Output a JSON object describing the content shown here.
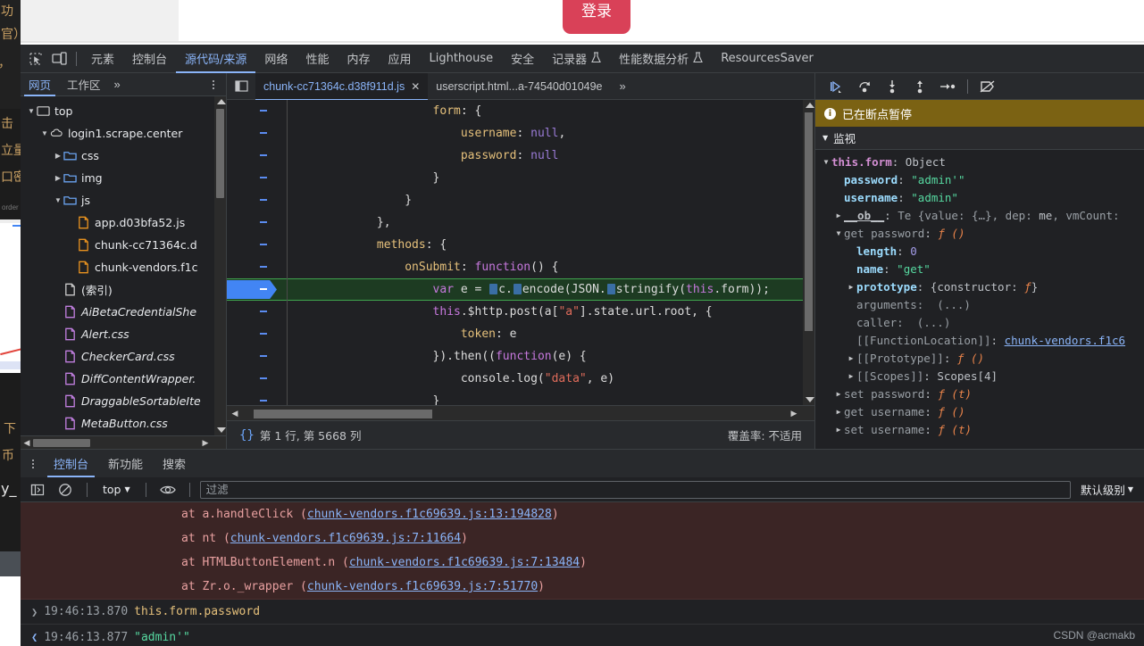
{
  "page": {
    "login_button_label": "登录"
  },
  "left_sliver": {
    "lines": [
      "击",
      "立",
      "口密",
      "下",
      "币",
      "y_"
    ],
    "small_label": "order"
  },
  "devtools": {
    "main_tabs": [
      {
        "label": "元素",
        "active": false,
        "flask": false
      },
      {
        "label": "控制台",
        "active": false,
        "flask": false
      },
      {
        "label": "源代码/来源",
        "active": true,
        "flask": false
      },
      {
        "label": "网络",
        "active": false,
        "flask": false
      },
      {
        "label": "性能",
        "active": false,
        "flask": false
      },
      {
        "label": "内存",
        "active": false,
        "flask": false
      },
      {
        "label": "应用",
        "active": false,
        "flask": false
      },
      {
        "label": "Lighthouse",
        "active": false,
        "flask": false
      },
      {
        "label": "安全",
        "active": false,
        "flask": false
      },
      {
        "label": "记录器",
        "active": false,
        "flask": true
      },
      {
        "label": "性能数据分析",
        "active": false,
        "flask": true
      },
      {
        "label": "ResourcesSaver",
        "active": false,
        "flask": false
      }
    ],
    "icons": {
      "inspect": "inspect-element-icon",
      "device": "device-toolbar-icon",
      "kebab": "more-options-icon"
    }
  },
  "navigator": {
    "tabs": [
      {
        "label": "网页",
        "active": true
      },
      {
        "label": "工作区",
        "active": false
      }
    ],
    "more_label": "»",
    "tree": [
      {
        "indent": 0,
        "twisty": "▼",
        "icon": "frame",
        "label": "top",
        "italic": false
      },
      {
        "indent": 1,
        "twisty": "▼",
        "icon": "cloud",
        "label": "login1.scrape.center",
        "italic": false
      },
      {
        "indent": 2,
        "twisty": "▶",
        "icon": "folder",
        "label": "css",
        "italic": false
      },
      {
        "indent": 2,
        "twisty": "▶",
        "icon": "folder",
        "label": "img",
        "italic": false
      },
      {
        "indent": 2,
        "twisty": "▼",
        "icon": "folder",
        "label": "js",
        "italic": false
      },
      {
        "indent": 3,
        "twisty": "",
        "icon": "file-js",
        "label": "app.d03bfa52.js",
        "italic": false
      },
      {
        "indent": 3,
        "twisty": "",
        "icon": "file-js",
        "label": "chunk-cc71364c.d",
        "italic": false
      },
      {
        "indent": 3,
        "twisty": "",
        "icon": "file-js",
        "label": "chunk-vendors.f1c",
        "italic": false
      },
      {
        "indent": 2,
        "twisty": "",
        "icon": "file-doc",
        "label": "(索引)",
        "italic": false
      },
      {
        "indent": 2,
        "twisty": "",
        "icon": "file-css",
        "label": "AiBetaCredentialShe",
        "italic": true
      },
      {
        "indent": 2,
        "twisty": "",
        "icon": "file-css",
        "label": "Alert.css",
        "italic": true
      },
      {
        "indent": 2,
        "twisty": "",
        "icon": "file-css",
        "label": "CheckerCard.css",
        "italic": true
      },
      {
        "indent": 2,
        "twisty": "",
        "icon": "file-css",
        "label": "DiffContentWrapper.",
        "italic": true
      },
      {
        "indent": 2,
        "twisty": "",
        "icon": "file-css",
        "label": "DraggableSortableIte",
        "italic": true
      },
      {
        "indent": 2,
        "twisty": "",
        "icon": "file-css",
        "label": "MetaButton.css",
        "italic": true
      }
    ]
  },
  "editor": {
    "tabs": [
      {
        "label": "chunk-cc71364c.d38f911d.js",
        "active": true,
        "closable": true
      },
      {
        "label": "userscript.html...a-74540d01049e",
        "active": false,
        "closable": false
      }
    ],
    "more_label": "»",
    "lines": [
      {
        "cur": false,
        "tokens": [
          {
            "t": "                    ",
            "c": "plain"
          },
          {
            "t": "form",
            "c": "prop"
          },
          {
            "t": ": {",
            "c": "white"
          }
        ]
      },
      {
        "cur": false,
        "tokens": [
          {
            "t": "                        ",
            "c": "plain"
          },
          {
            "t": "username",
            "c": "prop"
          },
          {
            "t": ": ",
            "c": "white"
          },
          {
            "t": "null",
            "c": "null"
          },
          {
            "t": ",",
            "c": "white"
          }
        ]
      },
      {
        "cur": false,
        "tokens": [
          {
            "t": "                        ",
            "c": "plain"
          },
          {
            "t": "password",
            "c": "prop"
          },
          {
            "t": ": ",
            "c": "white"
          },
          {
            "t": "null",
            "c": "null"
          }
        ]
      },
      {
        "cur": false,
        "tokens": [
          {
            "t": "                    }",
            "c": "white"
          }
        ]
      },
      {
        "cur": false,
        "tokens": [
          {
            "t": "                }",
            "c": "white"
          }
        ]
      },
      {
        "cur": false,
        "tokens": [
          {
            "t": "            },",
            "c": "white"
          }
        ]
      },
      {
        "cur": false,
        "tokens": [
          {
            "t": "            ",
            "c": "plain"
          },
          {
            "t": "methods",
            "c": "prop"
          },
          {
            "t": ": {",
            "c": "white"
          }
        ]
      },
      {
        "cur": false,
        "tokens": [
          {
            "t": "                ",
            "c": "plain"
          },
          {
            "t": "onSubmit",
            "c": "prop"
          },
          {
            "t": ": ",
            "c": "white"
          },
          {
            "t": "function",
            "c": "kw"
          },
          {
            "t": "() {",
            "c": "white"
          }
        ]
      },
      {
        "cur": true,
        "tokens": [
          {
            "t": "                    ",
            "c": "plain"
          },
          {
            "t": "var",
            "c": "kw"
          },
          {
            "t": " e = ",
            "c": "white"
          },
          {
            "t": "▸",
            "c": "fold"
          },
          {
            "t": "c.",
            "c": "white"
          },
          {
            "t": "▸",
            "c": "fold"
          },
          {
            "t": "encode(JSON.",
            "c": "white"
          },
          {
            "t": "▸",
            "c": "fold"
          },
          {
            "t": "stringify(",
            "c": "white"
          },
          {
            "t": "this",
            "c": "kw"
          },
          {
            "t": ".form));",
            "c": "white"
          }
        ]
      },
      {
        "cur": false,
        "tokens": [
          {
            "t": "                    ",
            "c": "plain"
          },
          {
            "t": "this",
            "c": "kw"
          },
          {
            "t": ".$http.post(a[",
            "c": "white"
          },
          {
            "t": "\"a\"",
            "c": "str"
          },
          {
            "t": "].state.url.root, {",
            "c": "white"
          }
        ]
      },
      {
        "cur": false,
        "tokens": [
          {
            "t": "                        ",
            "c": "plain"
          },
          {
            "t": "token",
            "c": "prop"
          },
          {
            "t": ": e",
            "c": "white"
          }
        ]
      },
      {
        "cur": false,
        "tokens": [
          {
            "t": "                    }).then((",
            "c": "white"
          },
          {
            "t": "function",
            "c": "kw"
          },
          {
            "t": "(e) {",
            "c": "white"
          }
        ]
      },
      {
        "cur": false,
        "tokens": [
          {
            "t": "                        console.log(",
            "c": "white"
          },
          {
            "t": "\"data\"",
            "c": "str"
          },
          {
            "t": ", e)",
            "c": "white"
          }
        ]
      },
      {
        "cur": false,
        "tokens": [
          {
            "t": "                    }",
            "c": "white"
          }
        ]
      },
      {
        "cur": false,
        "tokens": [
          {
            "t": "                    ))",
            "c": "white"
          }
        ]
      },
      {
        "cur": false,
        "tokens": [
          {
            "t": "                }",
            "c": "white"
          }
        ]
      },
      {
        "cur": false,
        "tokens": [
          {
            "t": "            }",
            "c": "white"
          }
        ]
      },
      {
        "cur": false,
        "tokens": [
          {
            "t": "        }",
            "c": "white"
          }
        ]
      }
    ],
    "status": {
      "position": "第 1 行, 第 5668 列",
      "coverage": "覆盖率: 不适用",
      "format_icon": "{}"
    }
  },
  "debugger": {
    "toolbar_icons": [
      "resume-script-icon",
      "step-over-icon",
      "step-into-icon",
      "step-out-icon",
      "step-icon",
      "deactivate-breakpoints-icon"
    ],
    "paused_text": "已在断点暂停",
    "watch_title": "监视",
    "watch_rows": [
      {
        "twisty": "▼",
        "indent": 0,
        "parts": [
          {
            "t": "this.form",
            "c": "name2"
          },
          {
            "t": ": ",
            "c": "plain"
          },
          {
            "t": "Object",
            "c": "plain"
          }
        ]
      },
      {
        "twisty": "",
        "indent": 1,
        "parts": [
          {
            "t": "password",
            "c": "name"
          },
          {
            "t": ": ",
            "c": "plain"
          },
          {
            "t": "\"admin'\"",
            "c": "str"
          }
        ]
      },
      {
        "twisty": "",
        "indent": 1,
        "parts": [
          {
            "t": "username",
            "c": "name"
          },
          {
            "t": ": ",
            "c": "plain"
          },
          {
            "t": "\"admin\"",
            "c": "str"
          }
        ]
      },
      {
        "twisty": "▶",
        "indent": 1,
        "parts": [
          {
            "t": "__ob__",
            "c": "ob"
          },
          {
            "t": ": ",
            "c": "plain"
          },
          {
            "t": "Te {value: {…}, dep: ",
            "c": "grey"
          },
          {
            "t": "me",
            "c": "plain"
          },
          {
            "t": ", vmCount:",
            "c": "grey"
          }
        ]
      },
      {
        "twisty": "▼",
        "indent": 1,
        "parts": [
          {
            "t": "get password",
            "c": "grey"
          },
          {
            "t": ": ",
            "c": "plain"
          },
          {
            "t": "ƒ ()",
            "c": "fn"
          }
        ]
      },
      {
        "twisty": "",
        "indent": 2,
        "parts": [
          {
            "t": "length",
            "c": "name"
          },
          {
            "t": ": ",
            "c": "plain"
          },
          {
            "t": "0",
            "c": "num"
          }
        ]
      },
      {
        "twisty": "",
        "indent": 2,
        "parts": [
          {
            "t": "name",
            "c": "name"
          },
          {
            "t": ": ",
            "c": "plain"
          },
          {
            "t": "\"get\"",
            "c": "str"
          }
        ]
      },
      {
        "twisty": "▶",
        "indent": 2,
        "parts": [
          {
            "t": "prototype",
            "c": "name"
          },
          {
            "t": ": ",
            "c": "plain"
          },
          {
            "t": "{constructor: ",
            "c": "plain"
          },
          {
            "t": "ƒ",
            "c": "fn"
          },
          {
            "t": "}",
            "c": "plain"
          }
        ]
      },
      {
        "twisty": "",
        "indent": 2,
        "parts": [
          {
            "t": "arguments",
            "c": "grey"
          },
          {
            "t": ":  (...)",
            "c": "grey"
          }
        ]
      },
      {
        "twisty": "",
        "indent": 2,
        "parts": [
          {
            "t": "caller",
            "c": "grey"
          },
          {
            "t": ":  (...)",
            "c": "grey"
          }
        ]
      },
      {
        "twisty": "",
        "indent": 2,
        "parts": [
          {
            "t": "[[FunctionLocation]]",
            "c": "grey"
          },
          {
            "t": ": ",
            "c": "plain"
          },
          {
            "t": "chunk-vendors.f1c6",
            "c": "link"
          }
        ]
      },
      {
        "twisty": "▶",
        "indent": 2,
        "parts": [
          {
            "t": "[[Prototype]]",
            "c": "grey"
          },
          {
            "t": ": ",
            "c": "plain"
          },
          {
            "t": "ƒ ()",
            "c": "fn"
          }
        ]
      },
      {
        "twisty": "▶",
        "indent": 2,
        "parts": [
          {
            "t": "[[Scopes]]",
            "c": "grey"
          },
          {
            "t": ": ",
            "c": "plain"
          },
          {
            "t": "Scopes[4]",
            "c": "plain"
          }
        ]
      },
      {
        "twisty": "▶",
        "indent": 1,
        "parts": [
          {
            "t": "set password",
            "c": "grey"
          },
          {
            "t": ": ",
            "c": "plain"
          },
          {
            "t": "ƒ (t)",
            "c": "fn"
          }
        ]
      },
      {
        "twisty": "▶",
        "indent": 1,
        "parts": [
          {
            "t": "get username",
            "c": "grey"
          },
          {
            "t": ": ",
            "c": "plain"
          },
          {
            "t": "ƒ ()",
            "c": "fn"
          }
        ]
      },
      {
        "twisty": "▶",
        "indent": 1,
        "parts": [
          {
            "t": "set username",
            "c": "grey"
          },
          {
            "t": ": ",
            "c": "plain"
          },
          {
            "t": "ƒ (t)",
            "c": "fn"
          }
        ]
      }
    ]
  },
  "drawer": {
    "tabs": [
      {
        "label": "控制台",
        "active": true
      },
      {
        "label": "新功能",
        "active": false
      },
      {
        "label": "搜索",
        "active": false
      }
    ],
    "toolbar": {
      "context": "top",
      "filter_placeholder": "过滤",
      "filter_value": "",
      "level": "默认级别",
      "icons": [
        "sidebar-toggle-icon",
        "clear-console-icon",
        "eye-icon"
      ]
    },
    "error_lines": [
      {
        "text": "at a.handleClick (",
        "link": "chunk-vendors.f1c69639.js:13:194828",
        "tail": ")"
      },
      {
        "text": "at nt (",
        "link": "chunk-vendors.f1c69639.js:7:11664",
        "tail": ")"
      },
      {
        "text": "at HTMLButtonElement.n (",
        "link": "chunk-vendors.f1c69639.js:7:13484",
        "tail": ")"
      },
      {
        "text": "at Zr.o._wrapper (",
        "link": "chunk-vendors.f1c69639.js:7:51770",
        "tail": ")"
      }
    ],
    "command": {
      "arrow": "❯",
      "time": "19:46:13.870",
      "expr": "this.form.password"
    },
    "result": {
      "arrow": "❮",
      "time": "19:46:13.877",
      "value": "\"admin'\""
    }
  },
  "watermark": "CSDN @acmakb"
}
